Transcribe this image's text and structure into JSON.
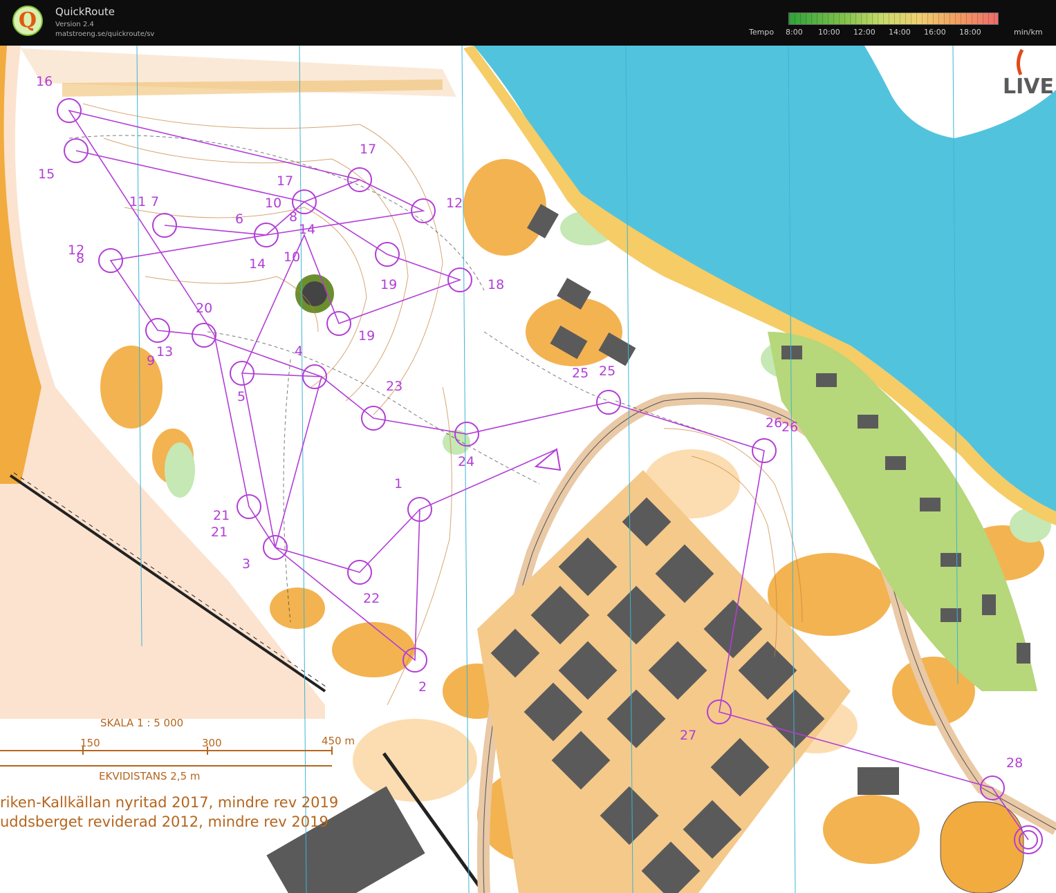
{
  "app": {
    "logo_letter": "Q",
    "title": "QuickRoute",
    "version": "Version 2.4",
    "url": "matstroeng.se/quickroute/sv"
  },
  "legend": {
    "label": "Tempo",
    "ticks": [
      "8:00",
      "10:00",
      "12:00",
      "14:00",
      "16:00",
      "18:00"
    ],
    "unit": "min/km",
    "colors": [
      "#2fa23a",
      "#7cc04a",
      "#c9dc6a",
      "#f0d070",
      "#f2a060",
      "#ee6b6b"
    ]
  },
  "map": {
    "watermark": "LIVE",
    "course_color": "#b23dd6",
    "water_color": "#52c3dd",
    "control_labels": [
      "16",
      "15",
      "17",
      "11",
      "7",
      "10",
      "6",
      "14",
      "17",
      "12",
      "8",
      "12",
      "13",
      "8",
      "14",
      "10",
      "18",
      "19",
      "19",
      "20",
      "9",
      "13",
      "4",
      "5",
      "23",
      "25",
      "25",
      "26",
      "26",
      "24",
      "1",
      "21",
      "21",
      "3",
      "22",
      "2",
      "27",
      "28"
    ],
    "scale": {
      "title": "SKALA 1 : 5 000",
      "ticks": [
        "150",
        "300",
        "450 m"
      ],
      "contour": "EKVIDISTANS 2,5 m"
    },
    "credits": [
      "riken-Kallkällan nyritad 2017, mindre rev 2019",
      "uddsberget reviderad 2012, mindre rev 2019"
    ]
  }
}
